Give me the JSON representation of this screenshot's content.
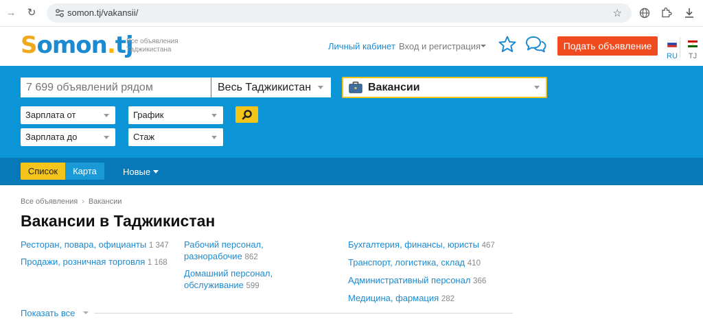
{
  "browser": {
    "url": "somon.tj/vakansii/"
  },
  "header": {
    "logo": {
      "s": "S",
      "omon": "omon",
      "dot": ".",
      "tj": "tj"
    },
    "tagline_line1": "Все объявления",
    "tagline_line2": "Таджикистана",
    "cabinet_link": "Личный кабинет",
    "login_link": "Вход и регистрация",
    "post_button": "Подать объявление",
    "lang_ru": "RU",
    "lang_tj": "TJ"
  },
  "search": {
    "input_placeholder": "7 699 объявлений рядом",
    "region": "Весь Таджикистан",
    "category": "Вакансии",
    "filters": {
      "salary_from": "Зарплата от",
      "salary_to": "Зарплата до",
      "schedule": "График",
      "experience": "Стаж"
    }
  },
  "view": {
    "list_label": "Список",
    "map_label": "Карта",
    "sort_label": "Новые"
  },
  "breadcrumb": {
    "root": "Все объявления",
    "current": "Вакансии"
  },
  "page_title": "Вакансии в Таджикистан",
  "categories": {
    "col1": [
      {
        "name": "Ресторан, повара, официанты",
        "count": "1 347"
      },
      {
        "name": "Продажи, розничная торговля",
        "count": "1 168"
      }
    ],
    "col2": [
      {
        "name": "Рабочий персонал, разнорабочие",
        "count": "862"
      },
      {
        "name": "Домашний персонал, обслуживание",
        "count": "599"
      }
    ],
    "col3": [
      {
        "name": "Бухгалтерия, финансы, юристы",
        "count": "467"
      },
      {
        "name": "Транспорт, логистика, склад",
        "count": "410"
      },
      {
        "name": "Административный персонал",
        "count": "366"
      },
      {
        "name": "Медицина, фармация",
        "count": "282"
      }
    ]
  },
  "show_all": "Показать все",
  "colors": {
    "brand_blue": "#0b94d6",
    "bar_blue": "#0879b8",
    "accent_yellow": "#f3c51a",
    "post_orange": "#ef4b1f",
    "link_blue": "#1c8ad1"
  }
}
